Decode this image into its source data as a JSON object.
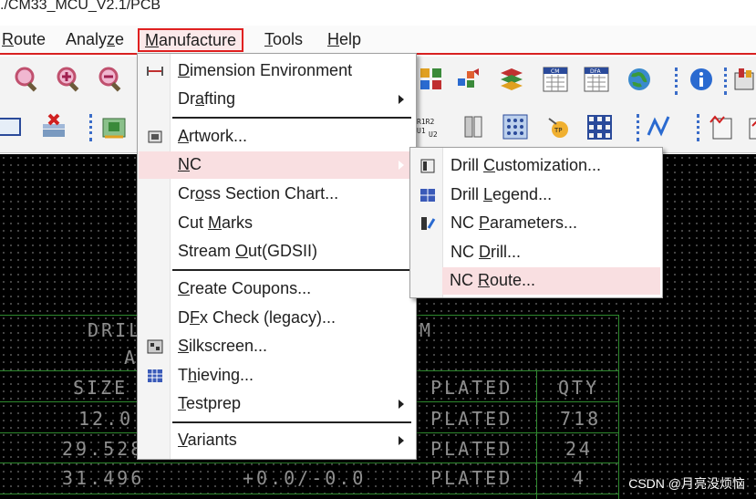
{
  "title": "./CM33_MCU_V2.1/PCB",
  "menubar": {
    "items": [
      {
        "label": "Route",
        "u": "R",
        "rest": "oute"
      },
      {
        "label": "Analyze",
        "pre": "Analy",
        "u": "z",
        "rest": "e"
      },
      {
        "label": "Manufacture",
        "u": "M",
        "rest": "anufacture"
      },
      {
        "label": "Tools",
        "u": "T",
        "rest": "ools"
      },
      {
        "label": "Help",
        "u": "H",
        "rest": "elp"
      }
    ]
  },
  "manufacture_menu": {
    "items": [
      {
        "label": "Dimension Environment",
        "u": "D",
        "rest": "imension Environment",
        "icon": "dimension-icon"
      },
      {
        "label": "Drafting",
        "pre": "Dr",
        "u": "a",
        "rest": "fting",
        "submenu": true
      },
      {
        "label": "Artwork...",
        "u": "A",
        "rest": "rtwork...",
        "icon": "artwork-icon"
      },
      {
        "label": "NC",
        "pre": "",
        "u": "N",
        "rest": "C",
        "submenu": true
      },
      {
        "label": "Cross Section Chart...",
        "pre": "Cr",
        "u": "o",
        "rest": "ss Section Chart..."
      },
      {
        "label": "Cut Marks",
        "pre": "Cut ",
        "u": "M",
        "rest": "arks"
      },
      {
        "label": "Stream Out(GDSII)",
        "pre": "Stream ",
        "u": "O",
        "rest": "ut(GDSII)"
      },
      {
        "label": "Create Coupons...",
        "u": "C",
        "rest": "reate Coupons..."
      },
      {
        "label": "DFx Check (legacy)...",
        "pre": "D",
        "u": "F",
        "rest": "x Check (legacy)..."
      },
      {
        "label": "Silkscreen...",
        "u": "S",
        "rest": "ilkscreen...",
        "icon": "silkscreen-icon"
      },
      {
        "label": "Thieving...",
        "pre": "T",
        "u": "h",
        "rest": "ieving...",
        "icon": "thieving-icon"
      },
      {
        "label": "Testprep",
        "u": "T",
        "rest": "estprep",
        "submenu": true
      },
      {
        "label": "Variants",
        "u": "V",
        "rest": "ariants",
        "submenu": true
      }
    ]
  },
  "nc_submenu": {
    "items": [
      {
        "label": "Drill Customization...",
        "pre": "Drill ",
        "u": "C",
        "rest": "ustomization...",
        "icon": "drill-customization-icon"
      },
      {
        "label": "Drill Legend...",
        "pre": "Drill ",
        "u": "L",
        "rest": "egend...",
        "icon": "drill-legend-icon"
      },
      {
        "label": "NC Parameters...",
        "pre": "NC ",
        "u": "P",
        "rest": "arameters...",
        "icon": "nc-parameters-icon"
      },
      {
        "label": "NC Drill...",
        "pre": "NC ",
        "u": "D",
        "rest": "rill..."
      },
      {
        "label": "NC Route...",
        "pre": "NC ",
        "u": "R",
        "rest": "oute..."
      }
    ]
  },
  "canvas": {
    "texts": [
      "DRIL",
      "A",
      "M",
      "SIZE",
      "PLATED",
      "QTY",
      "12.0",
      "PLATED",
      "718",
      "29.528",
      "PLATED",
      "24",
      "31.496",
      "+0.0/-0.0",
      "PLATED",
      "4"
    ]
  },
  "toolbar_icons": {
    "row1": [
      "zoom-fit-icon",
      "zoom-in-icon",
      "zoom-out-icon",
      "grid-icon",
      "gradient-icon",
      "layers-icon",
      "cm-icon",
      "dfa-icon",
      "globe-icon",
      "info-icon",
      "board-icon"
    ],
    "row2": [
      "window-icon",
      "delete-icon",
      "chip-icon",
      "refdes-icon",
      "pin-icon",
      "matrix-icon",
      "testpoint-icon",
      "array-icon",
      "waveform-icon",
      "check-icon"
    ]
  },
  "watermark": "CSDN @月亮没烦恼",
  "colors": {
    "accent": "#e02020",
    "highlight": "#f9dfe1",
    "canvas": "#000000",
    "canvas_line": "#2e8a2e"
  }
}
